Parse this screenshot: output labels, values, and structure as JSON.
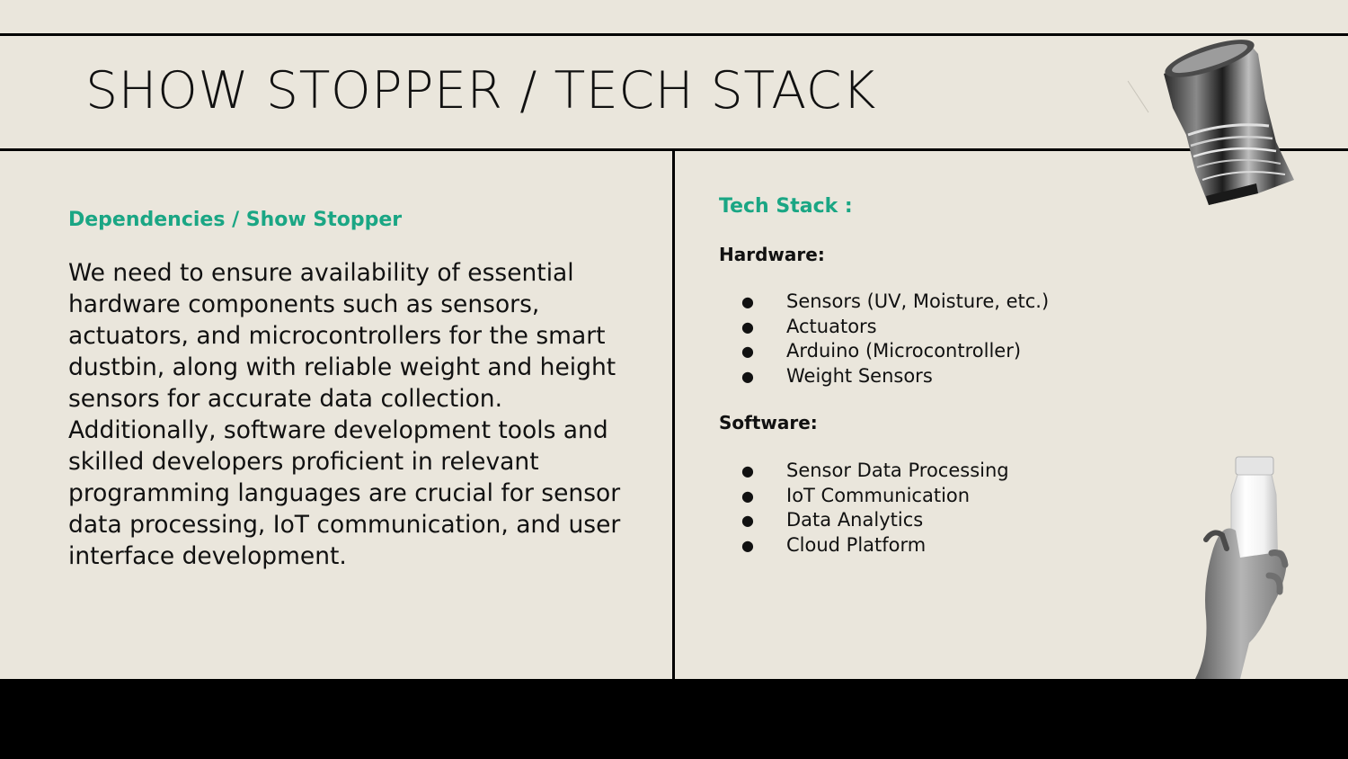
{
  "slide": {
    "title": "SHOW STOPPER / TECH STACK",
    "left": {
      "heading": "Dependencies / Show Stopper",
      "body": "We need to ensure availability of essential hardware components such as sensors, actuators, and microcontrollers for the smart dustbin, along with reliable weight and height sensors for accurate data collection. Additionally, software development tools and skilled developers proficient in relevant programming languages are crucial for sensor data processing, IoT communication, and user interface development."
    },
    "right": {
      "heading": "Tech Stack :",
      "hardware": {
        "label": "Hardware:",
        "items": [
          "Sensors (UV, Moisture, etc.)",
          "Actuators",
          "Arduino (Microcontroller)",
          "Weight Sensors"
        ]
      },
      "software": {
        "label": "Software:",
        "items": [
          "Sensor Data Processing",
          "IoT Communication",
          "Data Analytics",
          "Cloud Platform"
        ]
      }
    },
    "bullet_glyph": "●"
  },
  "colors": {
    "background": "#eae6dc",
    "accent": "#1aa684",
    "text": "#111111",
    "letterbox": "#000000"
  },
  "icons": {
    "top_right": "crushed-can-icon",
    "bottom_right": "hand-holding-bottle-icon"
  }
}
